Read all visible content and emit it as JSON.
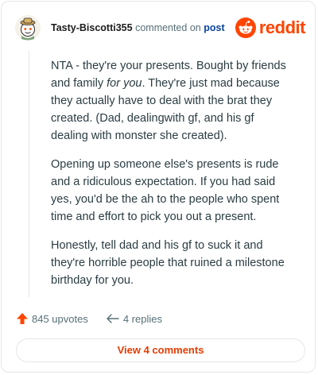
{
  "header": {
    "username": "Tasty-Biscotti355",
    "action_text": "commented on",
    "post_link": "post",
    "logo_text": "reddit"
  },
  "comment": {
    "paragraphs": [
      {
        "before": "NTA - they're your presents. Bought by friends and family ",
        "emphasis": "for you",
        "after": ". They're just mad because they actually have to deal with the brat they created. (Dad, dealingwith gf, and his gf dealing with monster she created)."
      },
      {
        "text": "Opening up someone else's presents is rude and a ridiculous expectation. If you had said yes, you'd be the ah to the people who spent time and effort to pick you out a present."
      },
      {
        "text": "Honestly, tell dad and his gf to suck it and they're horrible people that ruined a milestone birthday for you."
      }
    ]
  },
  "footer": {
    "upvotes": "845 upvotes",
    "replies": "4 replies",
    "upvote_icon": "upvote-arrow-icon",
    "reply_icon": "reply-arrow-icon"
  },
  "actions": {
    "view_comments": "View 4 comments"
  },
  "colors": {
    "brand": "#ff4500",
    "link": "#0a449b",
    "muted": "#576f76"
  }
}
